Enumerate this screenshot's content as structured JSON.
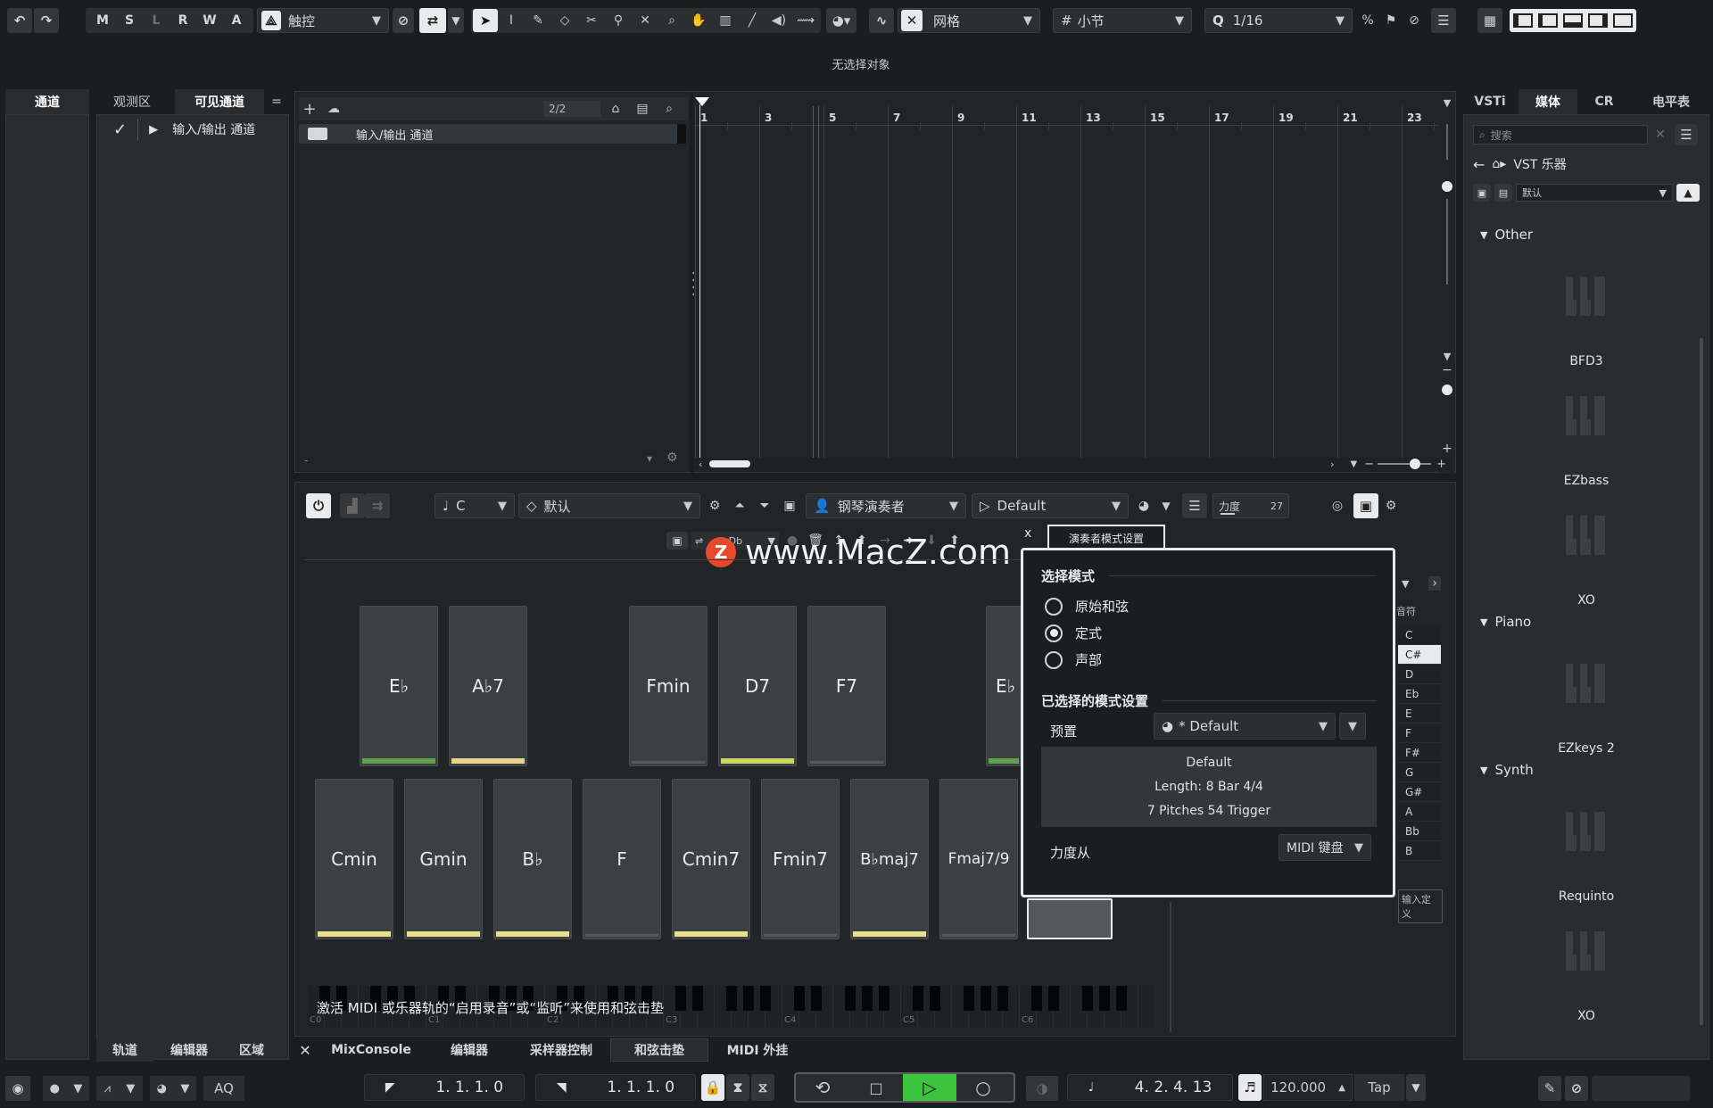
{
  "toolbar": {
    "msl": [
      "M",
      "S",
      "L",
      "R",
      "W",
      "A"
    ],
    "mode": "触控",
    "grid_type": "网格",
    "grid_unit": "小节",
    "quantize": "1/16"
  },
  "status": "无选择对象",
  "left_panel": {
    "tab_channel": "通道",
    "tab_inspector": "观测区",
    "tab_visible": "可见通道",
    "row": "输入/输出 通道"
  },
  "project": {
    "track_counter": "2/2",
    "folder_track": "输入/输出 通道",
    "ruler": [
      "1",
      "3",
      "5",
      "7",
      "9",
      "11",
      "13",
      "15",
      "17",
      "19",
      "21",
      "23"
    ]
  },
  "chord_pads": {
    "key": "C",
    "preset": "默认",
    "player": "钢琴演奏者",
    "pattern": "Default",
    "velocity_label": "力度",
    "velocity_value": "27",
    "small_key": "Db",
    "watermark": "www.MacZ.com",
    "top_pads": [
      "E♭",
      "A♭7",
      "Fmin",
      "D7",
      "F7",
      "E♭"
    ],
    "bottom_pads": [
      "Cmin",
      "Gmin",
      "B♭",
      "F",
      "Cmin7",
      "Fmin7",
      "B♭maj7",
      "Fmaj7/9"
    ],
    "hint": "激活 MIDI 或乐器轨的“启用录音”或“监听”来使用和弦击垫",
    "octaves": [
      "C0",
      "C1",
      "C2",
      "C3",
      "C4",
      "C5",
      "C6"
    ],
    "notes_header": "音符",
    "notes": [
      "C",
      "C#",
      "D",
      "Eb",
      "E",
      "F",
      "F#",
      "G",
      "G#",
      "A",
      "Bb",
      "B"
    ],
    "selected_note": "C#",
    "input_def": "输入定义"
  },
  "popup": {
    "tab": "演奏者模式设置",
    "select_mode": "选择模式",
    "mode_options": [
      "原始和弦",
      "定式",
      "声部"
    ],
    "selected_mode": "定式",
    "selected_settings": "已选择的模式设置",
    "preset_label": "预置",
    "preset_value": "* Default",
    "info_line1": "Default",
    "info_line2": "Length: 8  Bar 4/4",
    "info_line3": "7 Pitches 54 Trigger",
    "velocity_from": "力度从",
    "velocity_source": "MIDI 键盘"
  },
  "right_panel": {
    "tabs": [
      "VSTi",
      "媒体",
      "CR",
      "电平表"
    ],
    "search_placeholder": "搜索",
    "breadcrumb": "VST 乐器",
    "preset": "默认",
    "sections": [
      {
        "name": "Other",
        "items": [
          "BFD3",
          "EZbass",
          "XO"
        ]
      },
      {
        "name": "Piano",
        "items": [
          "EZkeys 2"
        ]
      },
      {
        "name": "Synth",
        "items": [
          "Requinto",
          "XO"
        ]
      }
    ]
  },
  "bottom_tabs": {
    "left": [
      "轨道",
      "编辑器",
      "区域"
    ],
    "zones": [
      "MixConsole",
      "编辑器",
      "采样器控制",
      "和弦击垫",
      "MIDI 外挂"
    ]
  },
  "transport": {
    "aq": "AQ",
    "left_locator": "1. 1. 1.   0",
    "right_locator": "1. 1. 1.   0",
    "position": "4. 2. 4. 13",
    "tempo": "120.000",
    "tap": "Tap"
  }
}
